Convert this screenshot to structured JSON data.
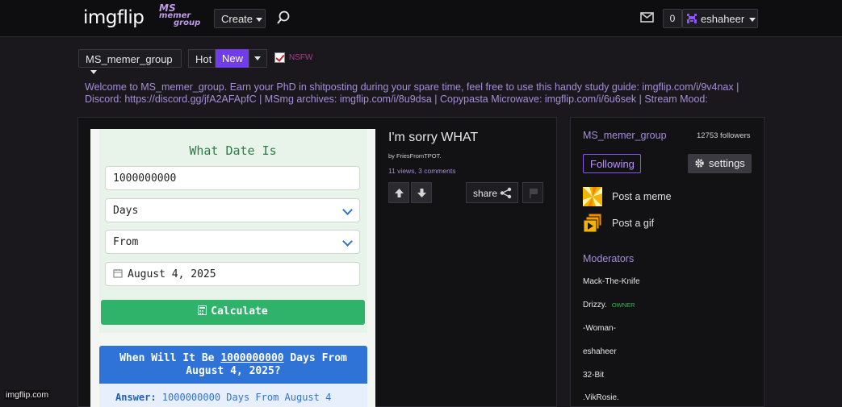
{
  "header": {
    "logo": "imgflip",
    "group_logo_lines": [
      "MS",
      "memer",
      "group"
    ],
    "create_label": "Create",
    "notifications_count": "0",
    "username": "eshaheer"
  },
  "toolbar": {
    "group_select": "MS_memer_group",
    "sort_hot": "Hot",
    "sort_new": "New",
    "nsfw_label": "NSFW",
    "nsfw_checked": true
  },
  "description": "Welcome to MS_memer_group. Earn your PhD in shitposting during your spare time, feel free to use this handy study guide: imgflip.com/i/9v4nax | Discord: https://discord.gg/jfA2AFApfC | MSmg archives: imgflip.com/i/8u9dsa | Copypasta Microwave: imgflip.com/i/6u6sek | Stream Mood:",
  "post": {
    "title": "I'm sorry WHAT",
    "by": "by FriesFromTPOT.",
    "stats": "11 views, 3 comments",
    "share_label": "share",
    "meme": {
      "heading": "What Date Is",
      "number_value": "1000000000",
      "unit_value": "Days",
      "direction_value": "From",
      "date_value": "August 4, 2025",
      "calculate_label": "Calculate",
      "question_prefix": "When Will It Be ",
      "question_number": "1000000000",
      "question_suffix": " Days From",
      "question_line2": "August 4, 2025?",
      "answer_label": "Answer:",
      "answer_text": " 1000000000 Days From August 4"
    }
  },
  "sidebar": {
    "group_name": "MS_memer_group",
    "followers": "12753 followers",
    "following_label": "Following",
    "settings_label": "settings",
    "post_meme_label": "Post a meme",
    "post_gif_label": "Post a gif",
    "moderators_heading": "Moderators",
    "moderators": [
      {
        "name": "Mack-The-Knife",
        "badge": ""
      },
      {
        "name": "Drizzy.",
        "badge": "OWNER"
      },
      {
        "name": "-Woman-",
        "badge": ""
      },
      {
        "name": "eshaheer",
        "badge": ""
      },
      {
        "name": "32-Bit",
        "badge": ""
      },
      {
        "name": ".VikRosie.",
        "badge": ""
      }
    ]
  },
  "watermark": "imgflip.com",
  "colors": {
    "accent_purple": "#6f3ee8",
    "link_purple": "#a48ed9",
    "owner_green": "#2fbf4f",
    "meme_green": "#2fb36b",
    "meme_blue": "#2f73d6"
  },
  "icons": [
    "search-icon",
    "mail-icon",
    "user-avatar-icon",
    "chevron-down-icon",
    "upvote-icon",
    "downvote-icon",
    "share-icon",
    "flag-icon",
    "gear-icon",
    "post-meme-icon",
    "post-gif-icon",
    "calendar-icon",
    "calculator-icon"
  ]
}
